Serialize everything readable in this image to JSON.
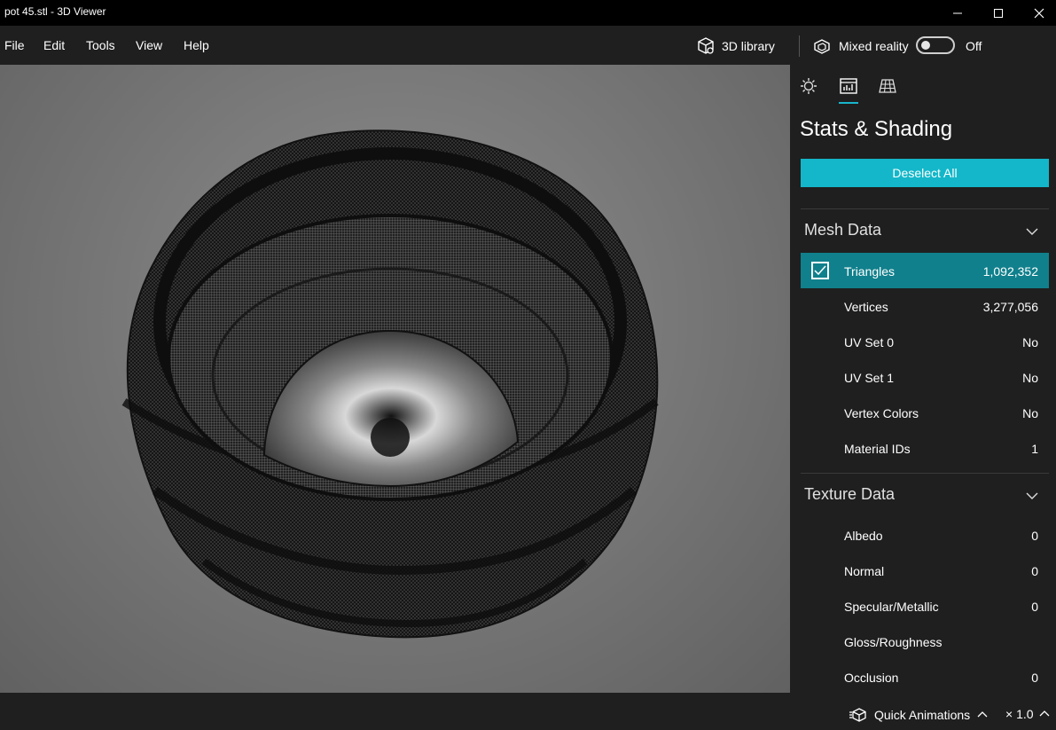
{
  "window": {
    "title": "pot 45.stl - 3D Viewer"
  },
  "menu": {
    "file": "File",
    "edit": "Edit",
    "tools": "Tools",
    "view": "View",
    "help": "Help"
  },
  "toolbar": {
    "library_label": "3D library",
    "mixed_reality_label": "Mixed reality",
    "mixed_reality_state": "Off",
    "mixed_reality_on": false
  },
  "panel": {
    "tabs": [
      "lighting-icon",
      "stats-icon",
      "grid-icon"
    ],
    "active_tab": "stats-icon",
    "title": "Stats & Shading",
    "deselect_label": "Deselect All",
    "mesh_section": "Mesh Data",
    "mesh_rows": [
      {
        "label": "Triangles",
        "value": "1,092,352",
        "checked": true
      },
      {
        "label": "Vertices",
        "value": "3,277,056"
      },
      {
        "label": "UV Set 0",
        "value": "No"
      },
      {
        "label": "UV Set 1",
        "value": "No"
      },
      {
        "label": "Vertex Colors",
        "value": "No"
      },
      {
        "label": "Material IDs",
        "value": "1"
      }
    ],
    "texture_section": "Texture Data",
    "texture_rows": [
      {
        "label": "Albedo",
        "value": "0"
      },
      {
        "label": "Normal",
        "value": "0"
      },
      {
        "label": "Specular/Metallic",
        "value": "0"
      },
      {
        "label": "Gloss/Roughness",
        "value": ""
      },
      {
        "label": "Occlusion",
        "value": "0"
      }
    ]
  },
  "status": {
    "quick_animations_label": "Quick Animations",
    "speed": "× 1.0"
  },
  "colors": {
    "accent": "#13b7c9",
    "selected_row": "#10808c",
    "background": "#1f1f1f"
  }
}
